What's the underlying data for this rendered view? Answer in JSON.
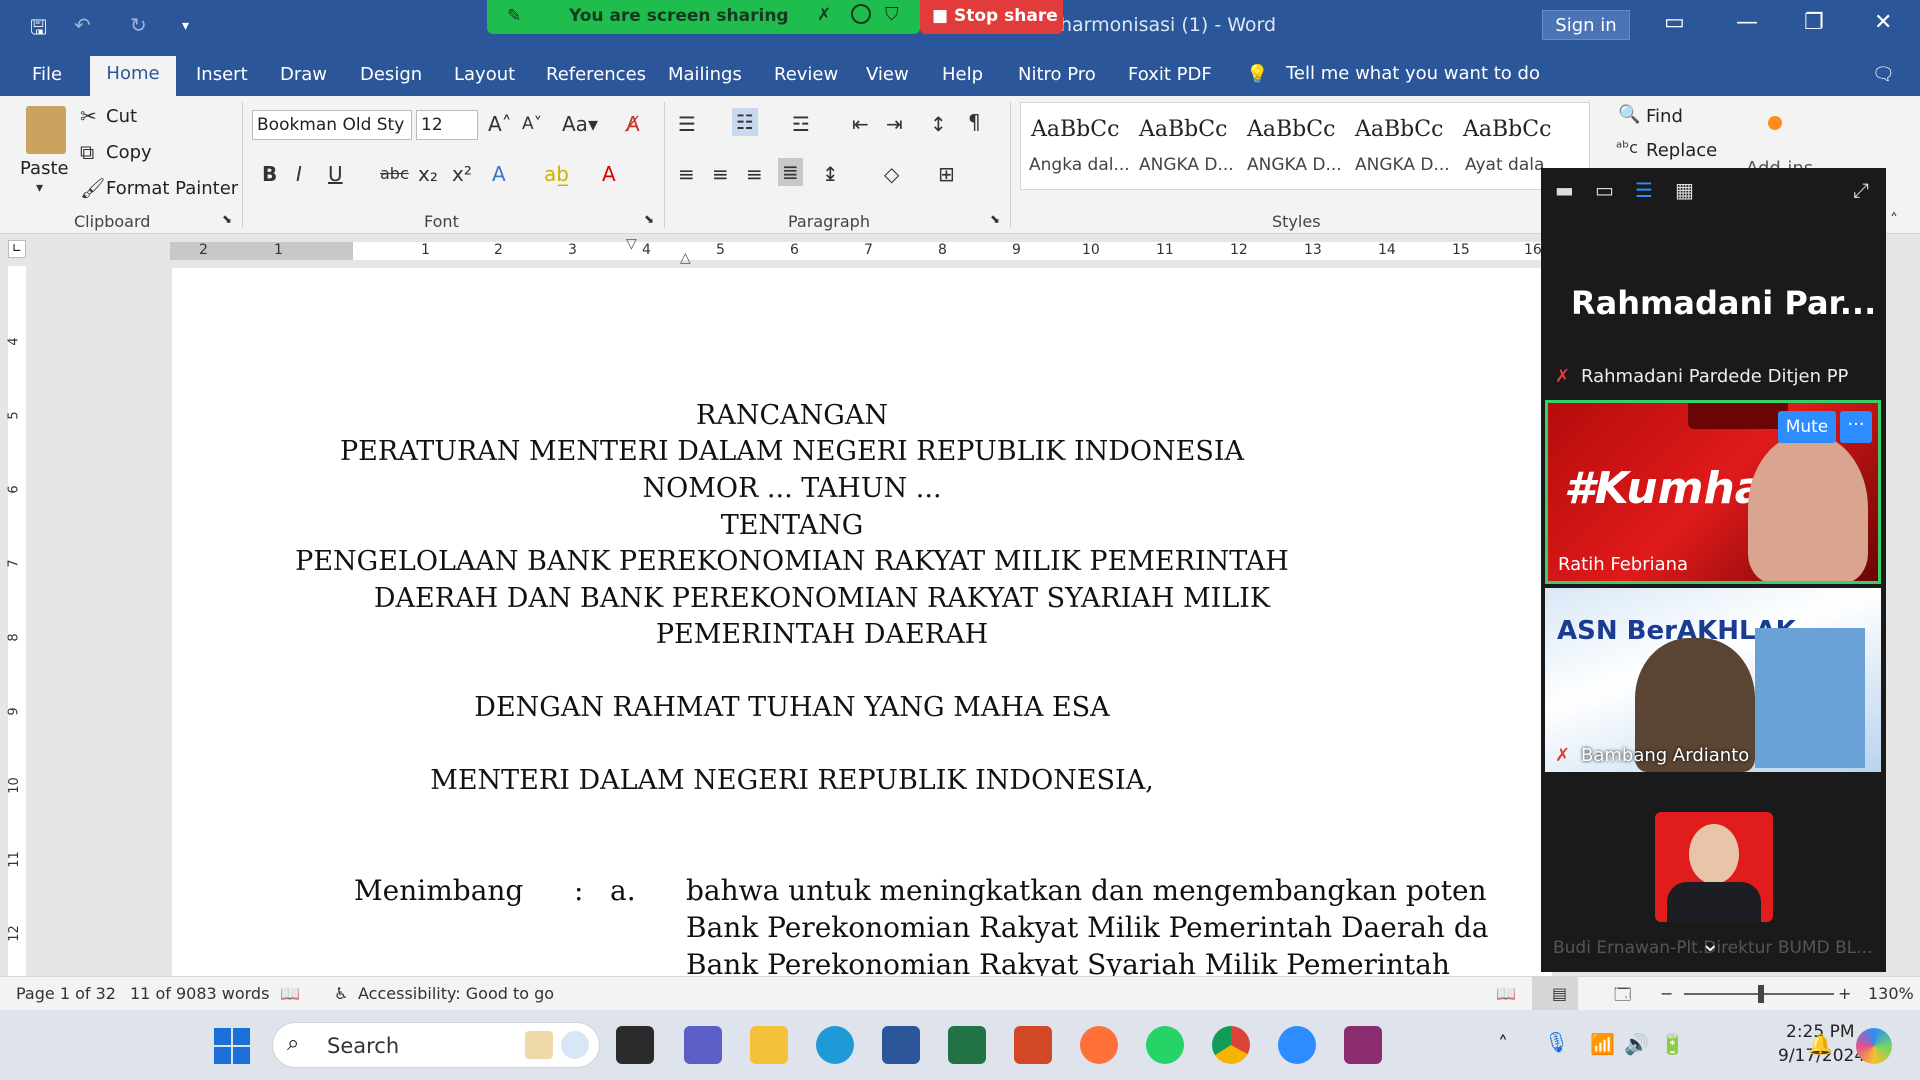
{
  "window": {
    "title": "harmonisasi (1)  -  Word",
    "signin_label": "Sign in"
  },
  "share": {
    "status": "You are screen sharing",
    "stop_label": "Stop share"
  },
  "menu": {
    "tabs": [
      "File",
      "Home",
      "Insert",
      "Draw",
      "Design",
      "Layout",
      "References",
      "Mailings",
      "Review",
      "View",
      "Help",
      "Nitro Pro",
      "Foxit PDF"
    ],
    "tell_me": "Tell me what you want to do"
  },
  "ribbon": {
    "clipboard": {
      "paste": "Paste",
      "cut": "Cut",
      "copy": "Copy",
      "format_painter": "Format Painter",
      "label": "Clipboard"
    },
    "font": {
      "name": "Bookman Old Sty",
      "size": "12",
      "label": "Font"
    },
    "paragraph": {
      "label": "Paragraph"
    },
    "styles": {
      "label": "Styles",
      "items": [
        {
          "sample": "AaBbCc",
          "name": "Angka dal..."
        },
        {
          "sample": "AaBbCc",
          "name": "ANGKA D..."
        },
        {
          "sample": "AaBbCc",
          "name": "ANGKA D..."
        },
        {
          "sample": "AaBbCc",
          "name": "ANGKA D..."
        },
        {
          "sample": "AaBbCc",
          "name": "Ayat dala"
        }
      ]
    },
    "editing": {
      "find": "Find",
      "replace": "Replace"
    },
    "addins": {
      "label": "Add-ins"
    }
  },
  "ruler": {
    "h_numbers": [
      "2",
      "1",
      "1",
      "2",
      "3",
      "4",
      "5",
      "6",
      "7",
      "8",
      "9",
      "10",
      "11",
      "12",
      "13",
      "14",
      "15",
      "16"
    ],
    "v_numbers": [
      "4",
      "5",
      "6",
      "7",
      "8",
      "9",
      "10",
      "11",
      "12"
    ]
  },
  "document": {
    "heading_lines": [
      "RANCANGAN",
      "PERATURAN MENTERI DALAM NEGERI REPUBLIK INDONESIA",
      "NOMOR ... TAHUN ...",
      "TENTANG",
      "PENGELOLAAN BANK PEREKONOMIAN RAKYAT MILIK PEMERINTAH",
      "DAERAH DAN BANK PEREKONOMIAN RAKYAT SYARIAH MILIK",
      "PEMERINTAH DAERAH"
    ],
    "grace": "DENGAN RAHMAT TUHAN YANG MAHA ESA",
    "minister": "MENTERI DALAM NEGERI REPUBLIK INDONESIA,",
    "menimbang_label": "Menimbang",
    "colon": ":",
    "item_letter": "a.",
    "body_lines": [
      "bahwa untuk meningkatkan dan mengembangkan poten",
      "Bank Perekonomian Rakyat Milik Pemerintah Daerah da",
      "Bank  Perekonomian  Rakyat  Syariah  Milik  Pemerintah"
    ]
  },
  "zoom": {
    "speaker_name": "Rahmadani  Par...",
    "speaker_full": "Rahmadani Pardede Ditjen PP",
    "participants": [
      {
        "name": "Ratih Febriana",
        "banner": "#Kumhar"
      },
      {
        "name": "Bambang Ardianto",
        "banner": "ASN BerAKHLAK"
      },
      {
        "name": "Budi Ernawan-Plt.Direktur BUMD BL..."
      }
    ],
    "mute_label": "Mute",
    "more_label": "···"
  },
  "status": {
    "page": "Page 1 of 32",
    "words": "11 of 9083 words",
    "accessibility": "Accessibility: Good to go",
    "zoom": "130%"
  },
  "taskbar": {
    "search": "Search",
    "time": "2:25 PM",
    "date": "9/17/2024"
  },
  "colors": {
    "word_blue": "#2b579a",
    "share_green": "#1fbd4d",
    "stop_red": "#e23b3b",
    "zoom_blue": "#2d8cff"
  }
}
